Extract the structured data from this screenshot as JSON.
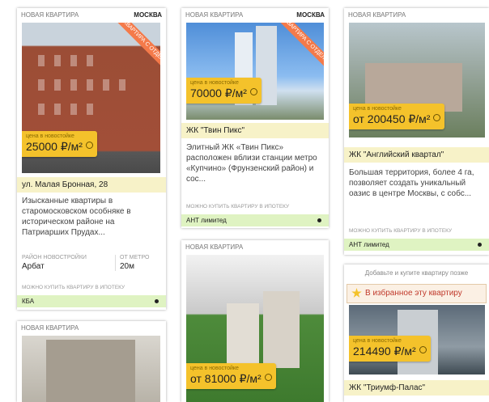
{
  "cards": [
    {
      "type": "НОВАЯ КВАРТИРА",
      "city": "МОСКВА",
      "ribbon": "КВАРТИРА С ОТДЕЛКОЙ",
      "price_label": "цена в новостойке",
      "price": "25000 ₽/м²",
      "title": "ул. Малая Бронная, 28",
      "desc": "Изысканные квартиры в старомосковском особняке в историческом районе на Патриарших Прудах...",
      "district_label": "РАЙОН НОВОСТРОЙКИ",
      "district": "Арбат",
      "metro_label": "ОТ МЕТРО",
      "metro": "20м",
      "mortgage": "МОЖНО КУПИТЬ КВАРТИРУ В ИПОТЕКУ",
      "developer": "КБА"
    },
    {
      "type": "НОВАЯ КВАРТИРА",
      "city": "МОСКВА",
      "ribbon": "КВАРТИРА С ОТДЕЛКОЙ",
      "price_label": "цена в новостойке",
      "price": "70000 ₽/м²",
      "title": "ЖК \"Твин Пикс\"",
      "desc": "Элитный ЖК «Твин Пикс» расположен вблизи станции метро «Купчино» (Фрунзенский район) и сос...",
      "mortgage": "МОЖНО КУПИТЬ КВАРТИРУ В ИПОТЕКУ",
      "developer": "АНТ лимитед"
    },
    {
      "type": "НОВАЯ КВАРТИРА",
      "price_label": "цена в новостойке",
      "price": "от 200450 ₽/м²",
      "title": "ЖК \"Английский квартал\"",
      "desc": "Большая территория, более 4 га, позволяет создать уникальный оазис в центре Москвы, с собс...",
      "mortgage": "МОЖНО КУПИТЬ КВАРТИРУ В ИПОТЕКУ",
      "developer": "АНТ лимитед"
    },
    {
      "type": "НОВАЯ КВАРТИРА"
    },
    {
      "type": "НОВАЯ КВАРТИРА",
      "price_label": "цена в новостойке",
      "price": "от 81000 ₽/м²"
    },
    {
      "top_note": "Добавьте и купите квартиру позже",
      "fav_label": "В избранное эту квартиру",
      "price_label": "цена в новостойке",
      "price": "214490 ₽/м²",
      "title": "ЖК \"Триумф-Палас\""
    }
  ]
}
